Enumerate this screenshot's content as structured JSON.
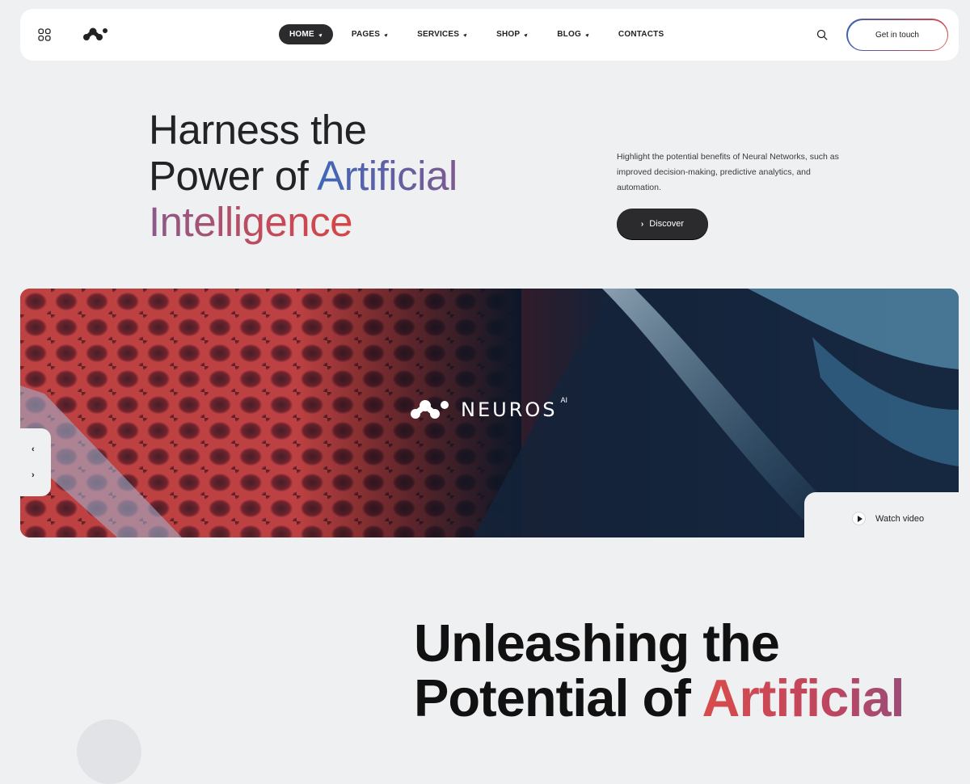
{
  "header": {
    "nav": [
      {
        "label": "HOME",
        "active": true,
        "dropdown": true
      },
      {
        "label": "PAGES",
        "active": false,
        "dropdown": true
      },
      {
        "label": "SERVICES",
        "active": false,
        "dropdown": true
      },
      {
        "label": "SHOP",
        "active": false,
        "dropdown": true
      },
      {
        "label": "BLOG",
        "active": false,
        "dropdown": true
      },
      {
        "label": "CONTACTS",
        "active": false,
        "dropdown": false
      }
    ],
    "cta_label": "Get in touch",
    "icons": {
      "menu": "grid-menu-icon",
      "search": "search-icon",
      "logo": "neuros-logo-mark"
    }
  },
  "hero": {
    "title_line1": "Harness the",
    "title_line2_a": "Power of ",
    "title_line2_b": "Artificial",
    "title_line3": "Intelligence",
    "description": "Highlight the potential benefits of Neural Networks, such as improved decision-making, predictive analytics, and automation.",
    "discover_label": "Discover"
  },
  "banner": {
    "brand_word": "NEUROS",
    "brand_sup": "AI",
    "watch_label": "Watch video"
  },
  "section2": {
    "title_line1": "Unleashing the",
    "title_line2_a": "Potential of ",
    "title_line2_b": "Artificial"
  },
  "colors": {
    "accent_blue": "#3f67b8",
    "accent_red": "#d84646",
    "dark": "#2b2b2d",
    "background": "#eff0f2"
  }
}
